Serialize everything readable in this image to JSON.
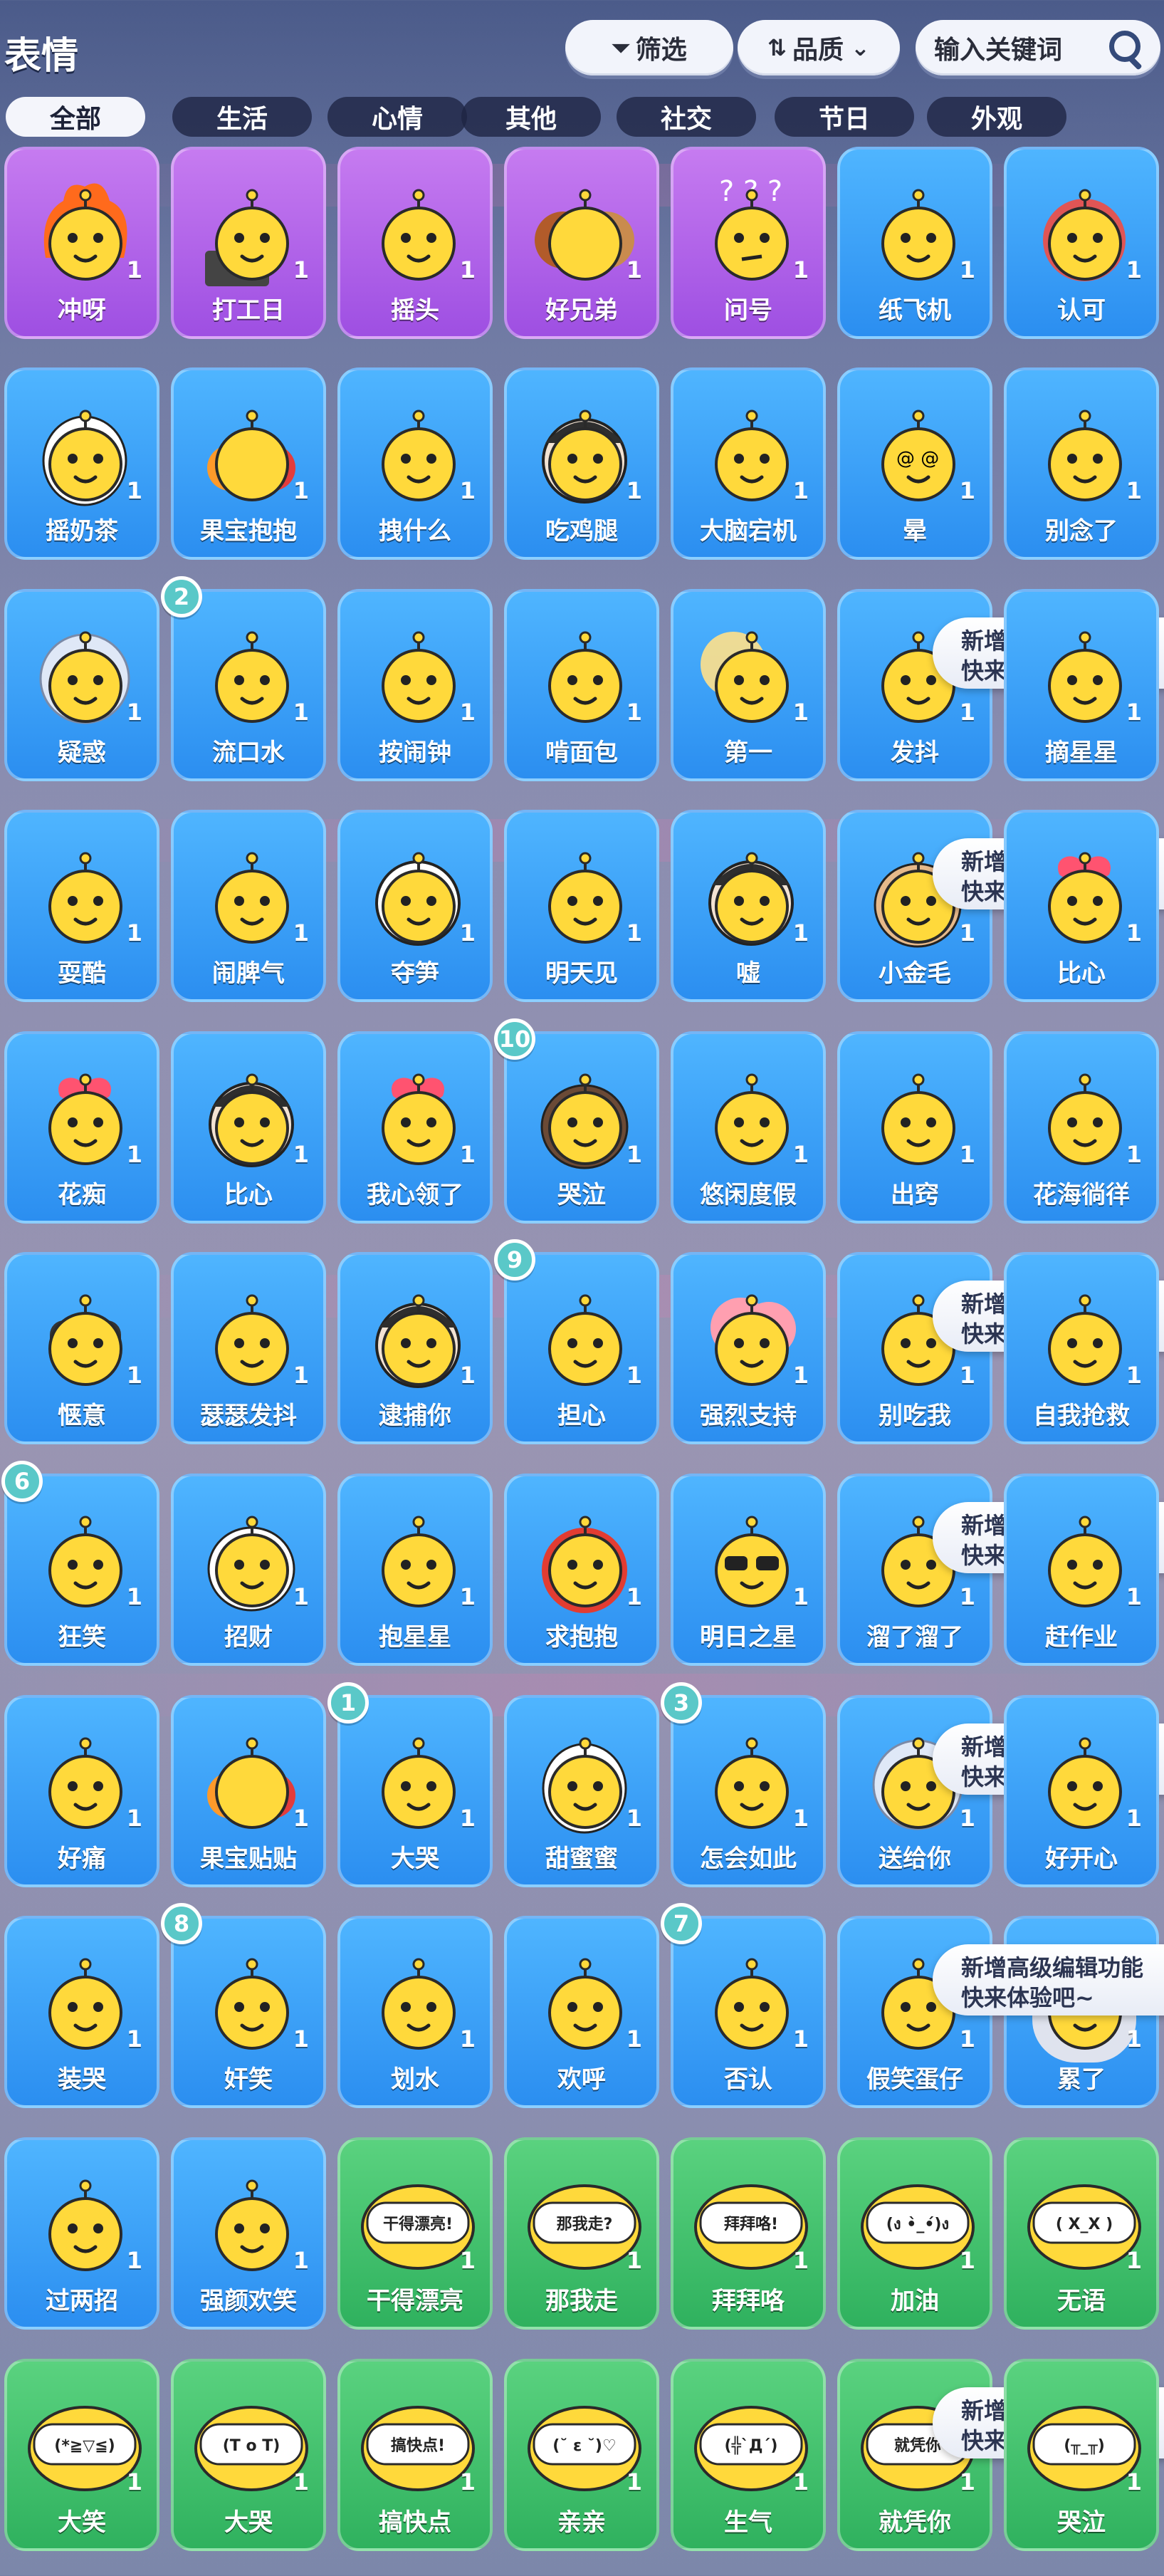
{
  "header": {
    "title": "表情",
    "filter_label": "筛选",
    "quality_label": "品质",
    "search_placeholder": "输入关键词"
  },
  "tabs": [
    "全部",
    "生活",
    "心情",
    "其他",
    "社交",
    "节日",
    "外观"
  ],
  "active_tab": 0,
  "tooltip": {
    "line1": "新增高级编辑功能",
    "line2": "快来体验吧~"
  },
  "colors": {
    "purple": "#9e4fe2",
    "blue": "#2b8ef0",
    "green": "#2fb15e",
    "badge": "#5ac8c8",
    "face": "#ffd93b"
  },
  "stickers": [
    {
      "label": "冲呀",
      "count": "1",
      "color": "purple",
      "art": "flame"
    },
    {
      "label": "打工日",
      "count": "1",
      "color": "purple",
      "art": "laptop"
    },
    {
      "label": "摇头",
      "count": "1",
      "color": "purple",
      "art": "smirk"
    },
    {
      "label": "好兄弟",
      "count": "1",
      "color": "purple",
      "art": "bears"
    },
    {
      "label": "问号",
      "count": "1",
      "color": "purple",
      "art": "question"
    },
    {
      "label": "纸飞机",
      "count": "1",
      "color": "blue",
      "art": "plane"
    },
    {
      "label": "认可",
      "count": "1",
      "color": "blue",
      "art": "pig"
    },
    {
      "label": "摇奶茶",
      "count": "1",
      "color": "blue",
      "art": "goose"
    },
    {
      "label": "果宝抱抱",
      "count": "1",
      "color": "blue",
      "art": "fruit"
    },
    {
      "label": "拽什么",
      "count": "1",
      "color": "blue",
      "art": "cool"
    },
    {
      "label": "吃鸡腿",
      "count": "1",
      "color": "blue",
      "art": "girl"
    },
    {
      "label": "大脑宕机",
      "count": "1",
      "color": "blue",
      "art": "blank"
    },
    {
      "label": "晕",
      "count": "1",
      "color": "blue",
      "art": "dizzy"
    },
    {
      "label": "别念了",
      "count": "1",
      "color": "blue",
      "art": "angry"
    },
    {
      "label": "疑惑",
      "count": "1",
      "color": "blue",
      "art": "ice"
    },
    {
      "label": "流口水",
      "count": "1",
      "color": "blue",
      "art": "drool",
      "badge": "2"
    },
    {
      "label": "按闹钟",
      "count": "1",
      "color": "blue",
      "art": "clock"
    },
    {
      "label": "啃面包",
      "count": "1",
      "color": "blue",
      "art": "bread"
    },
    {
      "label": "第一",
      "count": "1",
      "color": "blue",
      "art": "sun"
    },
    {
      "label": "发抖",
      "count": "1",
      "color": "blue",
      "art": "shiver",
      "tip": true
    },
    {
      "label": "摘星星",
      "count": "1",
      "color": "blue",
      "art": "star"
    },
    {
      "label": "耍酷",
      "count": "1",
      "color": "blue",
      "art": "king"
    },
    {
      "label": "闹脾气",
      "count": "1",
      "color": "blue",
      "art": "tantrum"
    },
    {
      "label": "夺笋",
      "count": "1",
      "color": "blue",
      "art": "panda"
    },
    {
      "label": "明天见",
      "count": "1",
      "color": "blue",
      "art": "wave"
    },
    {
      "label": "嘘",
      "count": "1",
      "color": "blue",
      "art": "bunny"
    },
    {
      "label": "小金毛",
      "count": "1",
      "color": "blue",
      "art": "dog",
      "tip": true
    },
    {
      "label": "比心",
      "count": "1",
      "color": "blue",
      "art": "heart"
    },
    {
      "label": "花痴",
      "count": "1",
      "color": "blue",
      "art": "hearteyes"
    },
    {
      "label": "比心",
      "count": "1",
      "color": "blue",
      "art": "joker"
    },
    {
      "label": "我心领了",
      "count": "1",
      "color": "blue",
      "art": "heartballoon"
    },
    {
      "label": "哭泣",
      "count": "1",
      "color": "blue",
      "art": "cry",
      "badge": "10"
    },
    {
      "label": "悠闲度假",
      "count": "1",
      "color": "blue",
      "art": "beach"
    },
    {
      "label": "出窍",
      "count": "1",
      "color": "blue",
      "art": "ghost"
    },
    {
      "label": "花海徜徉",
      "count": "1",
      "color": "blue",
      "art": "flowers"
    },
    {
      "label": "惬意",
      "count": "1",
      "color": "blue",
      "art": "relax"
    },
    {
      "label": "瑟瑟发抖",
      "count": "1",
      "color": "blue",
      "art": "cold"
    },
    {
      "label": "逮捕你",
      "count": "1",
      "color": "blue",
      "art": "detective"
    },
    {
      "label": "担心",
      "count": "1",
      "color": "blue",
      "art": "worry",
      "badge": "9"
    },
    {
      "label": "强烈支持",
      "count": "1",
      "color": "blue",
      "art": "cloud"
    },
    {
      "label": "别吃我",
      "count": "1",
      "color": "blue",
      "art": "pig2",
      "tip": true
    },
    {
      "label": "自我抢救",
      "count": "1",
      "color": "blue",
      "art": "rescue"
    },
    {
      "label": "狂笑",
      "count": "1",
      "color": "blue",
      "art": "laugh",
      "badge": "6"
    },
    {
      "label": "招财",
      "count": "1",
      "color": "blue",
      "art": "cat"
    },
    {
      "label": "抱星星",
      "count": "1",
      "color": "blue",
      "art": "hugstar"
    },
    {
      "label": "求抱抱",
      "count": "1",
      "color": "blue",
      "art": "tomato"
    },
    {
      "label": "明日之星",
      "count": "1",
      "color": "blue",
      "art": "sunglasses"
    },
    {
      "label": "溜了溜了",
      "count": "1",
      "color": "blue",
      "art": "scooter",
      "tip": true
    },
    {
      "label": "赶作业",
      "count": "1",
      "color": "blue",
      "art": "homework"
    },
    {
      "label": "好痛",
      "count": "1",
      "color": "blue",
      "art": "hurt"
    },
    {
      "label": "果宝贴贴",
      "count": "1",
      "color": "blue",
      "art": "fruit2"
    },
    {
      "label": "大哭",
      "count": "1",
      "color": "blue",
      "art": "bigcry",
      "badge": "1"
    },
    {
      "label": "甜蜜蜜",
      "count": "1",
      "color": "blue",
      "art": "goose2"
    },
    {
      "label": "怎会如此",
      "count": "1",
      "color": "blue",
      "art": "shock",
      "badge": "3"
    },
    {
      "label": "送给你",
      "count": "1",
      "color": "blue",
      "art": "ice2",
      "tip": true
    },
    {
      "label": "好开心",
      "count": "1",
      "color": "blue",
      "art": "happy"
    },
    {
      "label": "装哭",
      "count": "1",
      "color": "blue",
      "art": "fakecry"
    },
    {
      "label": "奸笑",
      "count": "1",
      "color": "blue",
      "art": "grin",
      "badge": "8"
    },
    {
      "label": "划水",
      "count": "1",
      "color": "blue",
      "art": "row"
    },
    {
      "label": "欢呼",
      "count": "1",
      "color": "blue",
      "art": "cheer"
    },
    {
      "label": "否认",
      "count": "1",
      "color": "blue",
      "art": "deny",
      "badge": "7"
    },
    {
      "label": "假笑蛋仔",
      "count": "1",
      "color": "blue",
      "art": "fakesmile"
    },
    {
      "label": "累了",
      "count": "1",
      "color": "blue",
      "art": "tired",
      "tip": true
    },
    {
      "label": "过两招",
      "count": "1",
      "color": "blue",
      "art": "fight"
    },
    {
      "label": "强颜欢笑",
      "count": "1",
      "color": "blue",
      "art": "forced"
    },
    {
      "label": "干得漂亮",
      "count": "1",
      "color": "green",
      "art": "text",
      "bubble": "干得漂亮!"
    },
    {
      "label": "那我走",
      "count": "1",
      "color": "green",
      "art": "text",
      "bubble": "那我走?"
    },
    {
      "label": "拜拜咯",
      "count": "1",
      "color": "green",
      "art": "text",
      "bubble": "拜拜咯!"
    },
    {
      "label": "加油",
      "count": "1",
      "color": "green",
      "art": "text",
      "bubble": "(ง •̀_•́)ง"
    },
    {
      "label": "无语",
      "count": "1",
      "color": "green",
      "art": "text",
      "bubble": "( X_X )"
    },
    {
      "label": "大笑",
      "count": "1",
      "color": "green",
      "art": "text",
      "bubble": "(*≧▽≦)"
    },
    {
      "label": "大哭",
      "count": "1",
      "color": "green",
      "art": "text",
      "bubble": "(T o T)"
    },
    {
      "label": "搞快点",
      "count": "1",
      "color": "green",
      "art": "text",
      "bubble": "搞快点!"
    },
    {
      "label": "亲亲",
      "count": "1",
      "color": "green",
      "art": "text",
      "bubble": "(˘ ε ˘)♡"
    },
    {
      "label": "生气",
      "count": "1",
      "color": "green",
      "art": "text",
      "bubble": "(╬`Д´)"
    },
    {
      "label": "就凭你",
      "count": "1",
      "color": "green",
      "art": "text",
      "bubble": "就凭你",
      "tip": true
    },
    {
      "label": "哭泣",
      "count": "1",
      "color": "green",
      "art": "text",
      "bubble": "(╥_╥)"
    }
  ]
}
